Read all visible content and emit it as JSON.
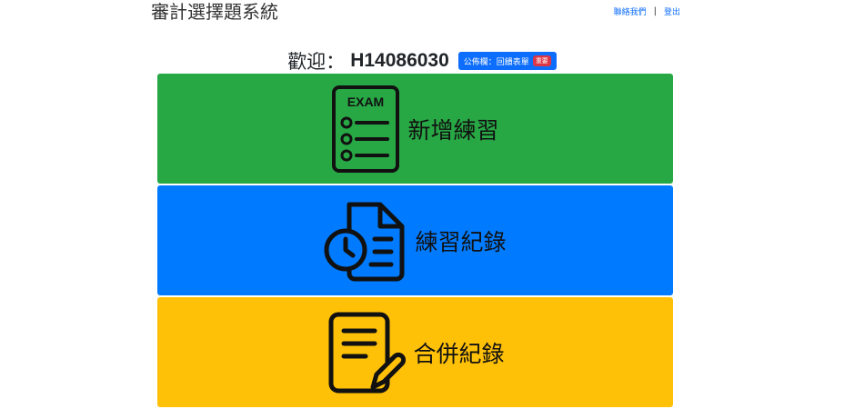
{
  "header": {
    "app_title": "審計選擇題系統",
    "contact_link": "聯絡我們",
    "separator": "|",
    "logout_link": "登出"
  },
  "welcome": {
    "prefix": "歡迎：",
    "user_id": "H14086030",
    "notice_button": "公佈欄：回饋表單",
    "notice_badge": "重要"
  },
  "cards": {
    "new_practice": {
      "label": "新增練習",
      "icon": "exam-icon",
      "color": "#28a745"
    },
    "practice_history": {
      "label": "練習紀錄",
      "icon": "document-clock-icon",
      "color": "#007bff"
    },
    "merged_history": {
      "label": "合併紀錄",
      "icon": "document-edit-icon",
      "color": "#ffc107"
    }
  },
  "icon_text": {
    "exam": "EXAM"
  },
  "colors": {
    "link": "#0d6efd",
    "badge": "#dc3545"
  }
}
